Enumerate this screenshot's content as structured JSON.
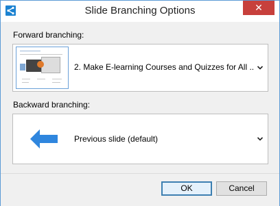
{
  "window": {
    "title": "Slide Branching Options",
    "close_glyph": "✕"
  },
  "forward": {
    "label": "Forward branching:",
    "selected": "2. Make E-learning Courses and Quizzes for All ..."
  },
  "backward": {
    "label": "Backward branching:",
    "selected": "Previous slide (default)"
  },
  "buttons": {
    "ok": "OK",
    "cancel": "Cancel"
  },
  "colors": {
    "accent": "#1b82d1",
    "close": "#c7403c",
    "arrow": "#2f86de"
  },
  "icons": {
    "app": "branching-app-icon",
    "back": "left-arrow-icon",
    "dropdown": "chevron-down-icon"
  }
}
